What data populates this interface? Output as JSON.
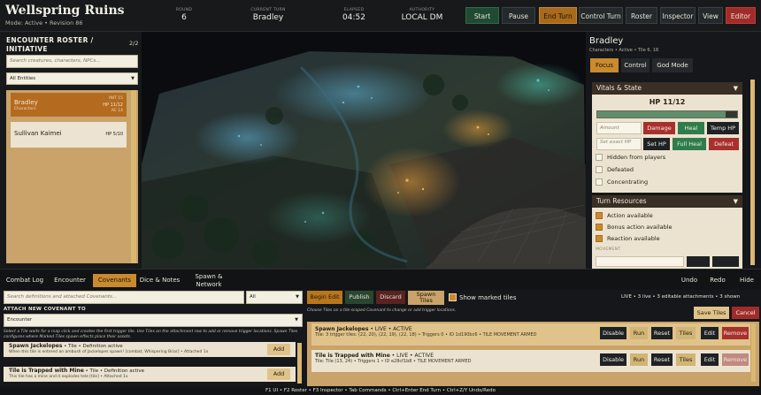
{
  "app": {
    "title": "Wellspring Ruins",
    "subtitle": "Mode: Active  •  Revision 86"
  },
  "header": {
    "round": {
      "label": "ROUND",
      "value": "6"
    },
    "turn": {
      "label": "CURRENT TURN",
      "value": "Bradley"
    },
    "elapsed": {
      "label": "ELAPSED",
      "value": "04:52"
    },
    "authority": {
      "label": "AUTHORITY",
      "value": "LOCAL DM"
    },
    "buttons": {
      "start": "Start",
      "pause": "Pause",
      "end_turn": "End Turn",
      "control_turn": "Control Turn",
      "roster": "Roster",
      "inspector": "Inspector",
      "view": "View",
      "editor": "Editor"
    }
  },
  "roster": {
    "title": "ENCOUNTER ROSTER / INITIATIVE",
    "count": "2/2",
    "search_placeholder": "Search creatures, characters, NPCs...",
    "filter": "All Entities",
    "combatants": [
      {
        "name": "Bradley",
        "type": "Characters",
        "initiative": "INIT 15",
        "hp": "HP 11/12",
        "ac": "AC 14"
      },
      {
        "name": "Sullivan Kaimei",
        "hp": "HP 5/10"
      }
    ]
  },
  "inspector": {
    "name": "Bradley",
    "subtitle": "Characters  •  Active  •  Tile 6, 18",
    "tabs": {
      "focus": "Focus",
      "control": "Control",
      "god_mode": "God Mode"
    },
    "vitals": {
      "title": "Vitals & State",
      "hp_text": "HP 11/12",
      "hp_fraction": 0.917,
      "amount_placeholder": "Amount",
      "damage": "Damage",
      "heal": "Heal",
      "temp_hp": "Temp HP",
      "set_exact_placeholder": "Set exact HP",
      "set_hp": "Set HP",
      "full_heal": "Full Heal",
      "defeat": "Defeat",
      "flags": [
        "Hidden from players",
        "Defeated",
        "Concentrating"
      ]
    },
    "turn_resources": {
      "title": "Turn Resources",
      "items": [
        "Action available",
        "Bonus action available",
        "Reaction available"
      ],
      "movement_label": "MOVEMENT"
    }
  },
  "bottom_tabs": {
    "combat_log": "Combat Log",
    "encounter": "Encounter",
    "covenants": "Covenants",
    "dice_notes": "Dice & Notes",
    "spawn_network": [
      "Spawn &",
      "Network"
    ],
    "undo": "Undo",
    "redo": "Redo",
    "hide": "Hide"
  },
  "covenants": {
    "search_placeholder": "Search definitions and attached Covenants...",
    "filter": "All",
    "attach_label": "ATTACH NEW COVENANT TO",
    "attach_target": "Encounter",
    "hint": "Select a Tile waits for a map click and creates the first trigger tile. Use Tiles on the attachment row to add or remove trigger locations. Spawn Tiles configures where Marked Tiles spawn effects place their assets.",
    "definitions": [
      {
        "name": "Spawn Jackelopes",
        "meta": "  •  Tile  •  Definition active",
        "desc": "When this tile is entered an ambush of Jackelopes spawn!  [combat, Whispering Briar]  •  Attached 1x",
        "add": "Add"
      },
      {
        "name": "Tile is Trapped with Mine",
        "meta": "  •  Tile  •  Definition active",
        "desc": "This tile has a mine and it explodes tele  [tile]  •  Attached 1x",
        "add": "Add"
      }
    ]
  },
  "attachments": {
    "begin_edit": "Begin Edit",
    "publish": "Publish",
    "discard": "Discard",
    "spawn_tiles": [
      "Spawn",
      "Tiles"
    ],
    "show_marked": "Show marked tiles",
    "status": "LIVE  •  3 live  •  3 editable attachments  •  3 shown",
    "choose_hint": "Choose Tiles on a tile-scoped Covenant to change or add trigger locations.",
    "save_tiles": "Save Tiles",
    "cancel": "Cancel",
    "items": [
      {
        "name": "Spawn Jackelopes",
        "meta": "  •  LIVE  •  ACTIVE",
        "desc": "Tile: 3 trigger tiles: (22, 20), (22, 19), (22, 18)  •  Triggers 0  •  ID 1d190bc6  •  TILE MOVEMENT ARMED",
        "buttons": [
          "Disable",
          "Run",
          "Reset",
          "Tiles",
          "Edit",
          "Remove"
        ]
      },
      {
        "name": "Tile is Trapped with Mine",
        "meta": "  •  LIVE  •  ACTIVE",
        "desc": "Tile: Tile (13, 24)  •  Triggers 1  •  ID e28cf1b8  •  TILE MOVEMENT ARMED",
        "buttons": [
          "Disable",
          "Run",
          "Reset",
          "Tiles",
          "Edit",
          "Remove"
        ]
      }
    ]
  },
  "footer": "F1 UI  •  F2 Roster  •  F3 Inspector  •  Tab Commands  •  Ctrl+Enter End Turn  •  Ctrl+Z/Y Undo/Redo",
  "colors": {
    "accent": "#c98a30",
    "danger": "#a8302c",
    "success": "#2e7d4a",
    "panel": "#ebe3cf"
  }
}
